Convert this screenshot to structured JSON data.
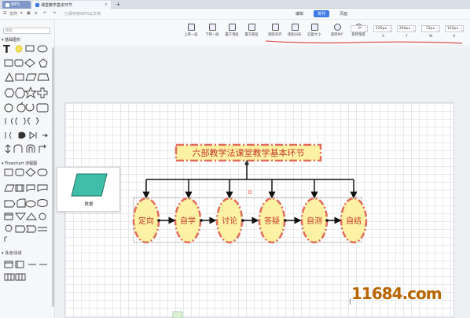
{
  "tabs": {
    "wps": "WPS",
    "document": "课堂教学基本环节",
    "add": "+"
  },
  "menubar": {
    "file": "文件",
    "saved_status": "已保存到WPS云文档",
    "menus": [
      "编辑",
      "排列",
      "页面"
    ],
    "active_menu": "排列"
  },
  "toolbar": {
    "buttons": [
      "上移一层",
      "下移一层",
      "置于顶层",
      "置于底层",
      "图形对齐",
      "图形分布",
      "匹配大小",
      "旋转90°",
      "旋转角度"
    ],
    "fields": [
      {
        "label": "",
        "value": "0°"
      },
      {
        "label": "X",
        "value": "226px"
      },
      {
        "label": "Y",
        "value": "294px"
      },
      {
        "label": "W",
        "value": "72px"
      },
      {
        "label": "H",
        "value": "125px"
      }
    ]
  },
  "sidebar": {
    "search_placeholder": "搜索",
    "sections": [
      "基础图形",
      "Flowchart 流程图",
      "泳池/泳道"
    ]
  },
  "popup": {
    "label": "数据"
  },
  "diagram": {
    "title": "六部教学法课堂教学基本环节",
    "steps": [
      "定向",
      "自学",
      "讨论",
      "答疑",
      "自测",
      "自结"
    ]
  },
  "watermark": "11684.com",
  "colors": {
    "accent": "#3d7be6",
    "node_fill": "#fdf2a3",
    "node_border": "#e26b5a",
    "node_text": "#c0392b",
    "watermark": "#b86600",
    "shape_teal": "#3fbfa9"
  }
}
